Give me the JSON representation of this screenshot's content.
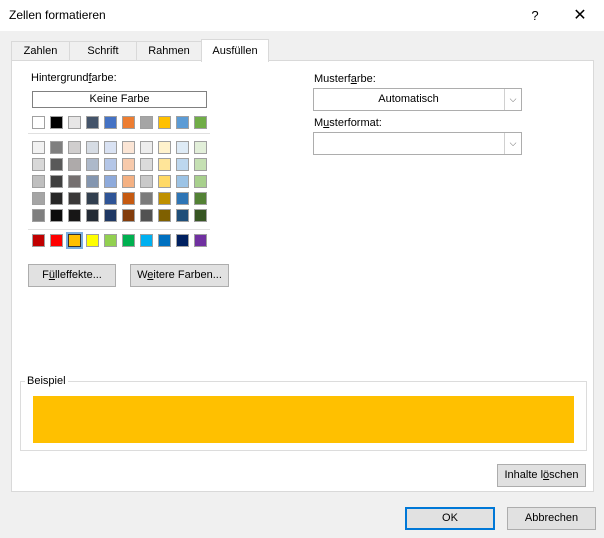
{
  "window": {
    "title": "Zellen formatieren",
    "help": "?",
    "close": "✕"
  },
  "tabs": [
    "Zahlen",
    "Schrift",
    "Rahmen",
    "Ausfüllen"
  ],
  "left": {
    "bg_label_pre": "Hintergrund",
    "bg_label_u": "f",
    "bg_label_post": "arbe:",
    "no_color": "Keine Farbe",
    "fill_effects_pre": "F",
    "fill_effects_u": "ü",
    "fill_effects_post": "lleffekte...",
    "more_colors_pre": "W",
    "more_colors_u": "e",
    "more_colors_post": "itere Farben..."
  },
  "right": {
    "pattern_color_pre": "Musterf",
    "pattern_color_u": "a",
    "pattern_color_post": "rbe:",
    "pattern_color_value": "Automatisch",
    "pattern_style_pre": "M",
    "pattern_style_u": "u",
    "pattern_style_post": "sterformat:",
    "pattern_style_value": ""
  },
  "sample": {
    "legend": "Beispiel",
    "color": "#FFC000"
  },
  "clear_pre": "Inhalte l",
  "clear_u": "ö",
  "clear_post": "schen",
  "ok": "OK",
  "cancel": "Abbrechen",
  "palette": {
    "theme_row": [
      "#FFFFFF",
      "#000000",
      "#E7E6E6",
      "#44546A",
      "#4472C4",
      "#ED7D31",
      "#A5A5A5",
      "#FFC000",
      "#5B9BD5",
      "#70AD47"
    ],
    "tints": [
      [
        "#F2F2F2",
        "#7F7F7F",
        "#D0CECE",
        "#D6DCE4",
        "#D9E2F3",
        "#FBE5D5",
        "#EDEDED",
        "#FFF2CC",
        "#DEEBF6",
        "#E2EFD9"
      ],
      [
        "#D8D8D8",
        "#595959",
        "#AEAAAA",
        "#ADB9CA",
        "#B4C6E7",
        "#F7CAAC",
        "#DBDBDB",
        "#FFE599",
        "#BDD7EE",
        "#C5E0B3"
      ],
      [
        "#BFBFBF",
        "#3F3F3F",
        "#757070",
        "#8496B0",
        "#8EAADB",
        "#F4B183",
        "#C9C9C9",
        "#FFD965",
        "#9CC3E5",
        "#A8D08D"
      ],
      [
        "#A5A5A5",
        "#262626",
        "#3A3838",
        "#323F4F",
        "#2F5496",
        "#C55A11",
        "#7B7B7B",
        "#BF9000",
        "#2E75B5",
        "#538135"
      ],
      [
        "#7F7F7F",
        "#0C0C0C",
        "#171616",
        "#222A35",
        "#1F3864",
        "#833C0B",
        "#525252",
        "#7F6000",
        "#1E4E79",
        "#375623"
      ]
    ],
    "standard": [
      "#C00000",
      "#FF0000",
      "#FFC000",
      "#FFFF00",
      "#92D050",
      "#00B050",
      "#00B0F0",
      "#0070C0",
      "#002060",
      "#7030A0"
    ],
    "selected": 2
  }
}
